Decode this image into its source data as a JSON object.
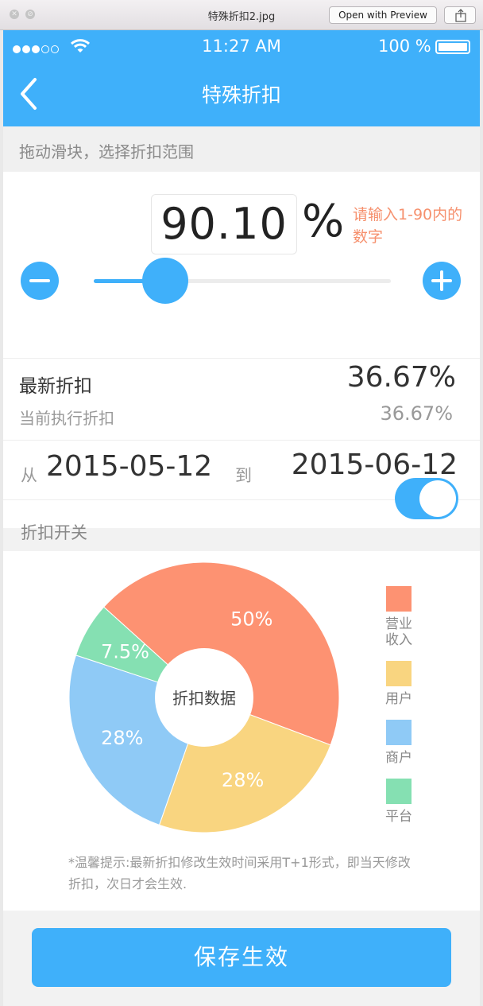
{
  "window": {
    "title": "特殊折扣2.jpg",
    "open_with": "Open with Preview"
  },
  "statusbar": {
    "time": "11:27 AM",
    "battery": "100 %"
  },
  "nav": {
    "title": "特殊折扣"
  },
  "hint": "拖动滑块，选择折扣范围",
  "discount": {
    "value": "90.10",
    "unit": "%",
    "tip": "请输入1-90内的数字",
    "slider_fraction": 0.24
  },
  "latest": {
    "label": "最新折扣",
    "value": "36.67%"
  },
  "current": {
    "label": "当前执行折扣",
    "value": "36.67%"
  },
  "period": {
    "from_label": "从",
    "from": "2015-05-12",
    "to_label": "到",
    "to": "2015-06-12"
  },
  "switch": {
    "label": "折扣开关",
    "on": true
  },
  "chart_data": {
    "type": "pie",
    "center_label": "折扣数据",
    "slices": [
      {
        "label": "营业收入",
        "value": 50,
        "display": "50%",
        "color": "#fd9272"
      },
      {
        "label": "用户",
        "value": 28,
        "display": "28%",
        "color": "#f9d580"
      },
      {
        "label": "商户",
        "value": 28,
        "display": "28%",
        "color": "#8fcaf6"
      },
      {
        "label": "平台",
        "value": 7.5,
        "display": "7.5%",
        "color": "#85e0b2"
      }
    ],
    "legend": [
      "营业收入",
      "用户",
      "商户",
      "平台"
    ],
    "legend_position": "right"
  },
  "note": "*温馨提示:最新折扣修改生效时间采用T+1形式，即当天修改折扣，次日才会生效.",
  "save_label": "保存生效",
  "colors": {
    "accent": "#3fb0fa",
    "tip": "#f6906d"
  }
}
